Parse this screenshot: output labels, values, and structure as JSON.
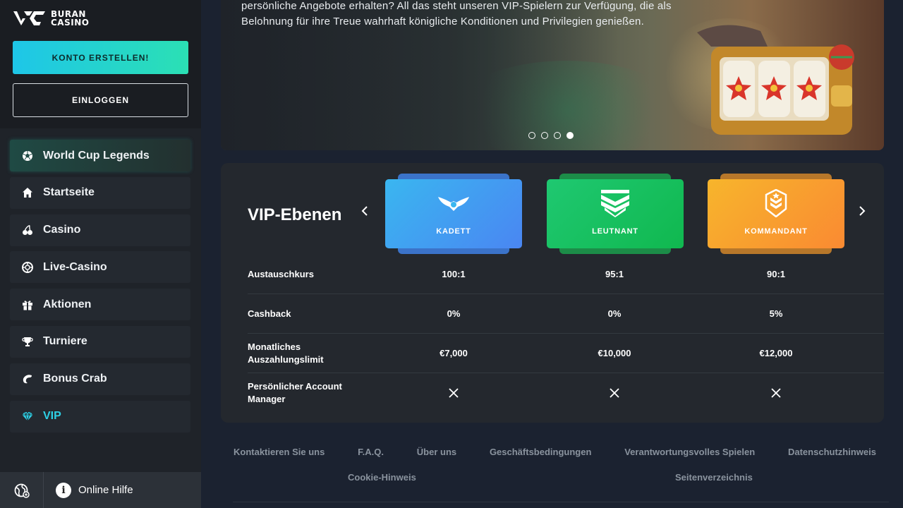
{
  "brand": {
    "line1": "BURAN",
    "line2": "CASINO"
  },
  "auth": {
    "register_label": "KONTO ERSTELLEN!",
    "login_label": "EINLOGGEN"
  },
  "nav": {
    "items": [
      {
        "label": "World Cup Legends",
        "icon": "soccer-ball-icon"
      },
      {
        "label": "Startseite",
        "icon": "home-icon"
      },
      {
        "label": "Casino",
        "icon": "cherries-icon"
      },
      {
        "label": "Live-Casino",
        "icon": "chip-icon"
      },
      {
        "label": "Aktionen",
        "icon": "gift-icon"
      },
      {
        "label": "Turniere",
        "icon": "trophy-icon"
      },
      {
        "label": "Bonus Crab",
        "icon": "crab-icon"
      },
      {
        "label": "VIP",
        "icon": "diamond-icon"
      }
    ]
  },
  "help": {
    "label": "Online Hilfe"
  },
  "hero": {
    "text": "persönliche Angebote erhalten? All das steht unseren VIP-Spielern zur Verfügung, die als Belohnung für ihre Treue wahrhaft königliche Konditionen und Privilegien genießen.",
    "active_slide": 4,
    "slide_count": 4
  },
  "vip": {
    "title": "VIP-Ebenen",
    "tiers": [
      {
        "name": "KADETT",
        "icon": "wings-icon"
      },
      {
        "name": "LEUTNANT",
        "icon": "chevron-badge-icon"
      },
      {
        "name": "KOMMANDANT",
        "icon": "rank-shield-icon"
      }
    ],
    "rows": [
      {
        "label": "Austauschkurs",
        "values": [
          "100:1",
          "95:1",
          "90:1"
        ]
      },
      {
        "label": "Cashback",
        "values": [
          "0%",
          "0%",
          "5%"
        ]
      },
      {
        "label": "Monatliches Auszahlungslimit",
        "values": [
          "€7,000",
          "€10,000",
          "€12,000"
        ]
      },
      {
        "label": "Persönlicher Account Manager",
        "values": [
          "cross",
          "cross",
          "cross"
        ]
      }
    ]
  },
  "footer": {
    "links": [
      "Kontaktieren Sie uns",
      "F.A.Q.",
      "Über uns",
      "Geschäftsbedingungen",
      "Verantwortungsvolles Spielen",
      "Datenschutzhinweis"
    ],
    "links2": [
      "Cookie-Hinweis",
      "Seitenverzeichnis"
    ]
  },
  "colors": {
    "accent": "#2ed0e6",
    "register_start": "#1ec6e8",
    "register_end": "#2be0b4"
  }
}
